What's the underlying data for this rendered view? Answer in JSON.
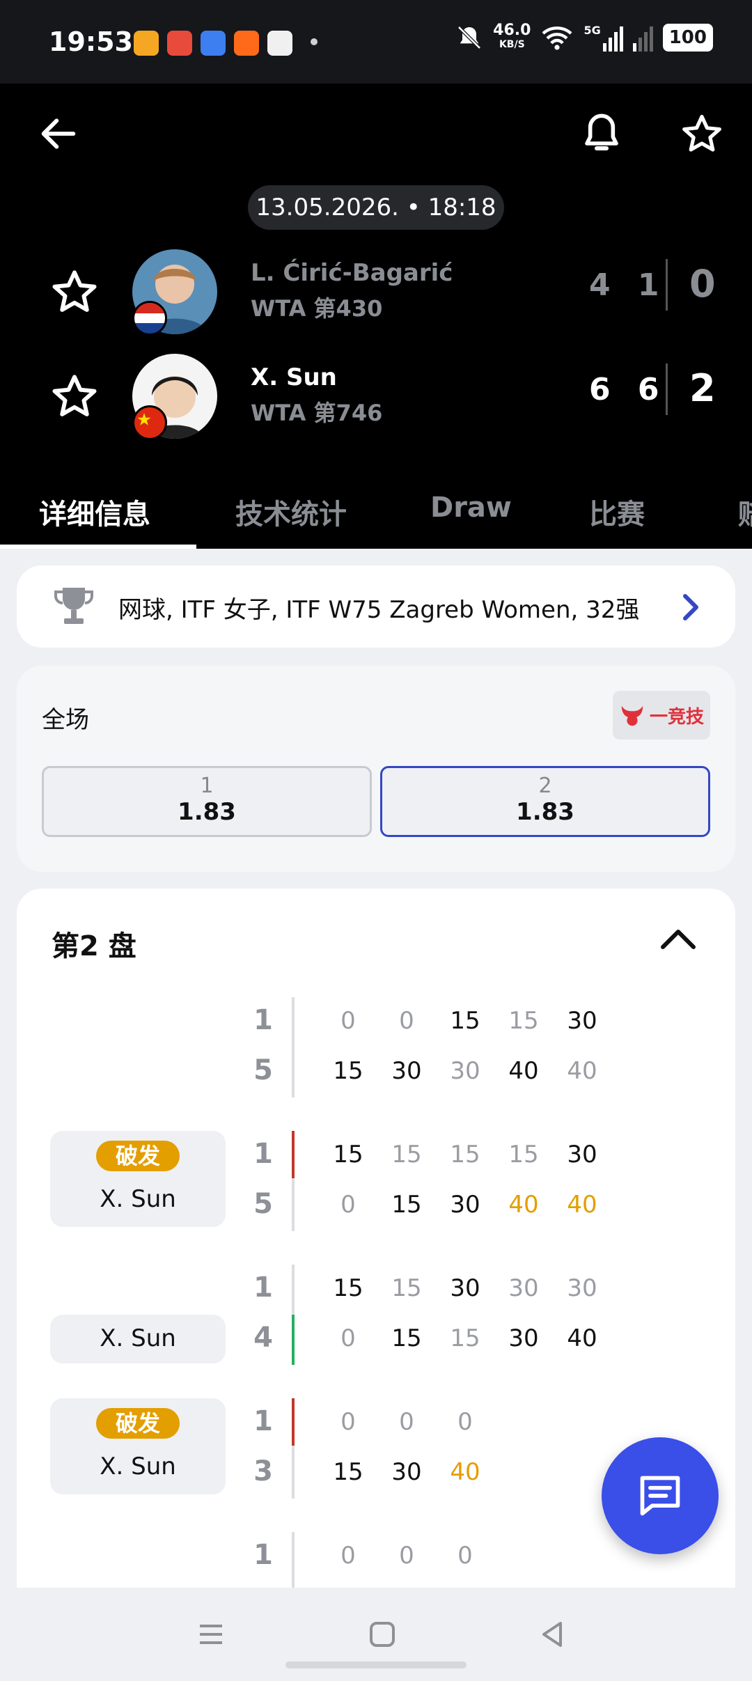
{
  "status_bar": {
    "time": "19:53",
    "net_speed": "46.0",
    "net_unit": "KB/S",
    "signal_label": "5G",
    "battery": "100",
    "app_icons": [
      "weibo-icon",
      "toutiao-icon",
      "baidu-icon",
      "taobao-icon",
      "oppo-icon"
    ]
  },
  "header": {
    "date": "13.05.2026. • 18:18"
  },
  "players": [
    {
      "name": "L. Ćirić-Bagarić",
      "rank": "WTA 第430",
      "games": "4 1",
      "sets": "0",
      "flag": "croatia-flag-icon",
      "winner": false
    },
    {
      "name": "X. Sun",
      "rank": "WTA 第746",
      "games": "6 6",
      "sets": "2",
      "flag": "china-flag-icon",
      "winner": true
    }
  ],
  "tabs": [
    {
      "label": "详细信息",
      "active": true
    },
    {
      "label": "技术统计",
      "active": false
    },
    {
      "label": "Draw",
      "active": false
    },
    {
      "label": "比赛",
      "active": false
    },
    {
      "label": "赔",
      "active": false
    }
  ],
  "tournament": {
    "text": "网球, ITF 女子, ITF W75 Zagreb Women, 32强"
  },
  "odds": {
    "title": "全场",
    "brand": "一竞技",
    "options": [
      {
        "label": "1",
        "value": "1.83",
        "selected": false
      },
      {
        "label": "2",
        "value": "1.83",
        "selected": true
      }
    ]
  },
  "set_detail": {
    "title": "第2 盘",
    "break_label": "破发",
    "games": [
      {
        "tag": "",
        "break": false,
        "score_top": "1",
        "score_bottom": "5",
        "marker": "none",
        "top_points": [
          [
            "0",
            "gray"
          ],
          [
            "0",
            "gray"
          ],
          [
            "15",
            "blk"
          ],
          [
            "15",
            "gray"
          ],
          [
            "30",
            "blk"
          ]
        ],
        "bottom_points": [
          [
            "15",
            "blk"
          ],
          [
            "30",
            "blk"
          ],
          [
            "30",
            "gray"
          ],
          [
            "40",
            "blk"
          ],
          [
            "40",
            "gray"
          ]
        ]
      },
      {
        "tag": "X. Sun",
        "break": true,
        "score_top": "1",
        "score_bottom": "5",
        "marker": "top-red",
        "top_points": [
          [
            "15",
            "blk"
          ],
          [
            "15",
            "gray"
          ],
          [
            "15",
            "gray"
          ],
          [
            "15",
            "gray"
          ],
          [
            "30",
            "blk"
          ]
        ],
        "bottom_points": [
          [
            "0",
            "gray"
          ],
          [
            "15",
            "blk"
          ],
          [
            "30",
            "blk"
          ],
          [
            "40",
            "org"
          ],
          [
            "40",
            "org"
          ]
        ]
      },
      {
        "tag": "X. Sun",
        "break": false,
        "score_top": "1",
        "score_bottom": "4",
        "marker": "bottom-green",
        "top_points": [
          [
            "15",
            "blk"
          ],
          [
            "15",
            "gray"
          ],
          [
            "30",
            "blk"
          ],
          [
            "30",
            "gray"
          ],
          [
            "30",
            "gray"
          ]
        ],
        "bottom_points": [
          [
            "0",
            "gray"
          ],
          [
            "15",
            "blk"
          ],
          [
            "15",
            "gray"
          ],
          [
            "30",
            "blk"
          ],
          [
            "40",
            "blk"
          ]
        ]
      },
      {
        "tag": "X. Sun",
        "break": true,
        "score_top": "1",
        "score_bottom": "3",
        "marker": "top-red",
        "top_points": [
          [
            "0",
            "gray"
          ],
          [
            "0",
            "gray"
          ],
          [
            "0",
            "gray"
          ]
        ],
        "bottom_points": [
          [
            "15",
            "blk"
          ],
          [
            "30",
            "blk"
          ],
          [
            "40",
            "org"
          ]
        ]
      },
      {
        "tag": "",
        "break": false,
        "score_top": "1",
        "score_bottom": "",
        "marker": "none",
        "top_points": [
          [
            "0",
            "gray"
          ],
          [
            "0",
            "gray"
          ],
          [
            "0",
            "gray"
          ]
        ],
        "bottom_points": []
      }
    ]
  },
  "colors": {
    "accent_blue": "#3447c4",
    "fab_blue": "#3a4ee8",
    "break_orange": "#e39e00",
    "server_red": "#c0392b",
    "server_green": "#27ae60"
  }
}
